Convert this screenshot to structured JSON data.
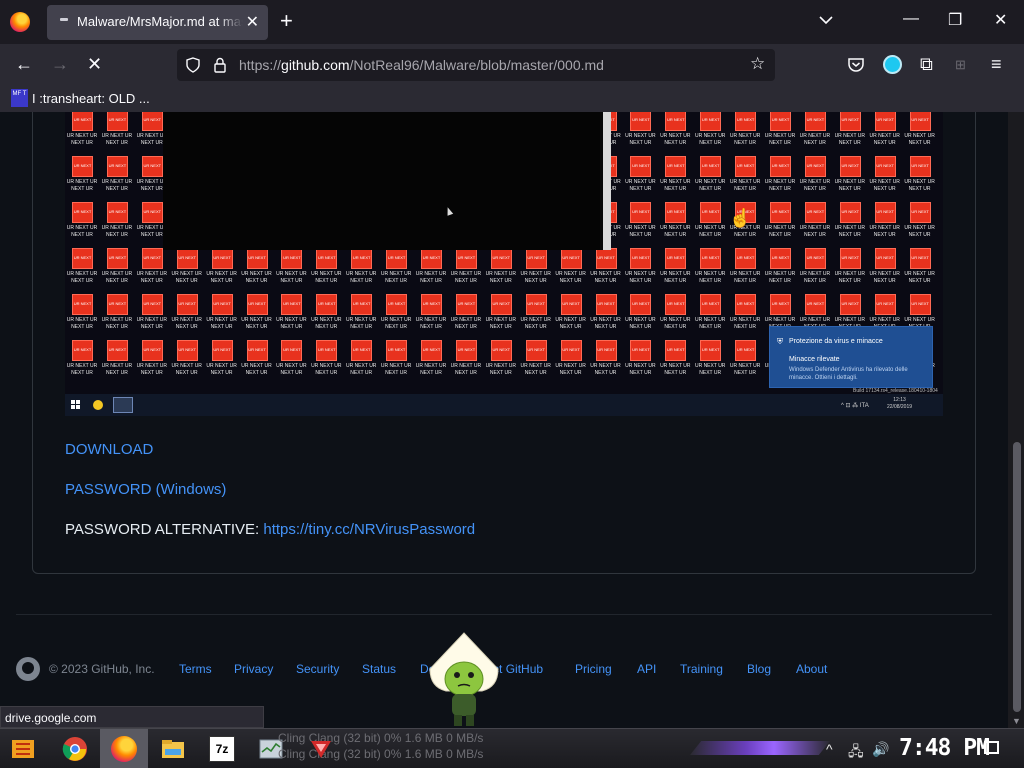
{
  "browser": {
    "tab_title": "Malware/MrsMajor.md at master",
    "new_tab": "+",
    "url_prefix": "https://",
    "url_domain": "github.com",
    "url_path": "/NotReal96/Malware/blob/master/000.md",
    "bookmark_icon_text": "MF T",
    "bookmark_label": "I :transheart: OLD ..."
  },
  "screenshot": {
    "icon_text": "UR NEXT",
    "icon_caption": "UR NEXT UR NEXT UR",
    "toast_header": "Protezione da virus e minacce",
    "toast_title": "Minacce rilevate",
    "toast_body": "Windows Defender Antivirus ha rilevato delle minacce. Ottieni i dettagli.",
    "build_text": "Build 17134.rs4_release.180410-1804",
    "tray_text": "^ ⊡ ⁂ ITA",
    "clock_time": "12:13",
    "clock_date": "22/08/2019"
  },
  "content": {
    "download": "DOWNLOAD",
    "password_windows": "PASSWORD (Windows)",
    "password_alt_label": "PASSWORD ALTERNATIVE: ",
    "password_alt_link": "https://tiny.cc/NRVirusPassword"
  },
  "footer": {
    "copyright": "© 2023 GitHub, Inc.",
    "links": [
      "Terms",
      "Privacy",
      "Security",
      "Status",
      "Docs",
      "Contact GitHub",
      "Pricing",
      "API",
      "Training",
      "Blog",
      "About"
    ]
  },
  "status_url": "drive.google.com",
  "taskbar": {
    "ghost_row1": "Cling Clang  (32 bit)          0%      1.6 MB      0 MB/s",
    "ghost_row2": "Cling Clang  (32 bit)          0%      1.6 MB      0 MB/s",
    "clock": "7:48 PM"
  },
  "colors": {
    "page_bg": "#0d1117",
    "link": "#4493f8",
    "icon_red": "#e8321e",
    "toast_blue": "#1f4f93"
  }
}
